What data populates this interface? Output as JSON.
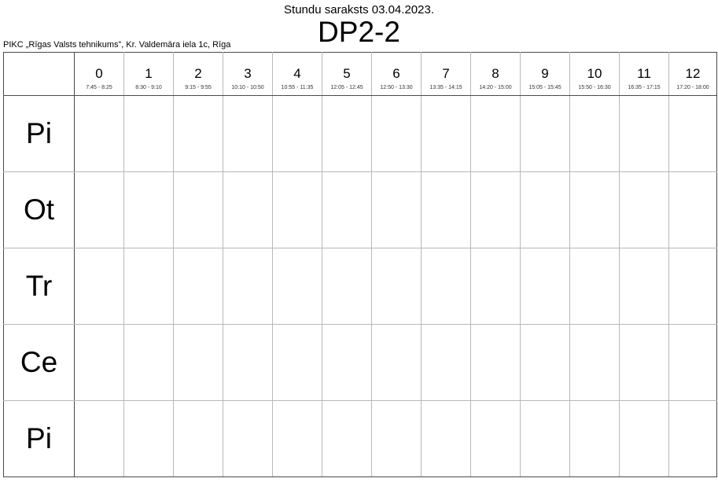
{
  "header": {
    "subtitle": "Stundu saraksts 03.04.2023.",
    "title": "DP2-2",
    "school": "PIKC „Rīgas Valsts tehnikums”, Kr. Valdemāra iela 1c, Rīga"
  },
  "periods": [
    {
      "num": "0",
      "time": "7:45 - 8:25"
    },
    {
      "num": "1",
      "time": "8:30 - 9:10"
    },
    {
      "num": "2",
      "time": "9:15 - 9:55"
    },
    {
      "num": "3",
      "time": "10:10 - 10:50"
    },
    {
      "num": "4",
      "time": "10:55 - 11:35"
    },
    {
      "num": "5",
      "time": "12:05 - 12:45"
    },
    {
      "num": "6",
      "time": "12:50 - 13:30"
    },
    {
      "num": "7",
      "time": "13:35 - 14:15"
    },
    {
      "num": "8",
      "time": "14:20 - 15:00"
    },
    {
      "num": "9",
      "time": "15:05 - 15:45"
    },
    {
      "num": "10",
      "time": "15:50 - 16:30"
    },
    {
      "num": "11",
      "time": "16:35 - 17:15"
    },
    {
      "num": "12",
      "time": "17:20 - 18:00"
    }
  ],
  "days": [
    "Pi",
    "Ot",
    "Tr",
    "Ce",
    "Pi"
  ]
}
